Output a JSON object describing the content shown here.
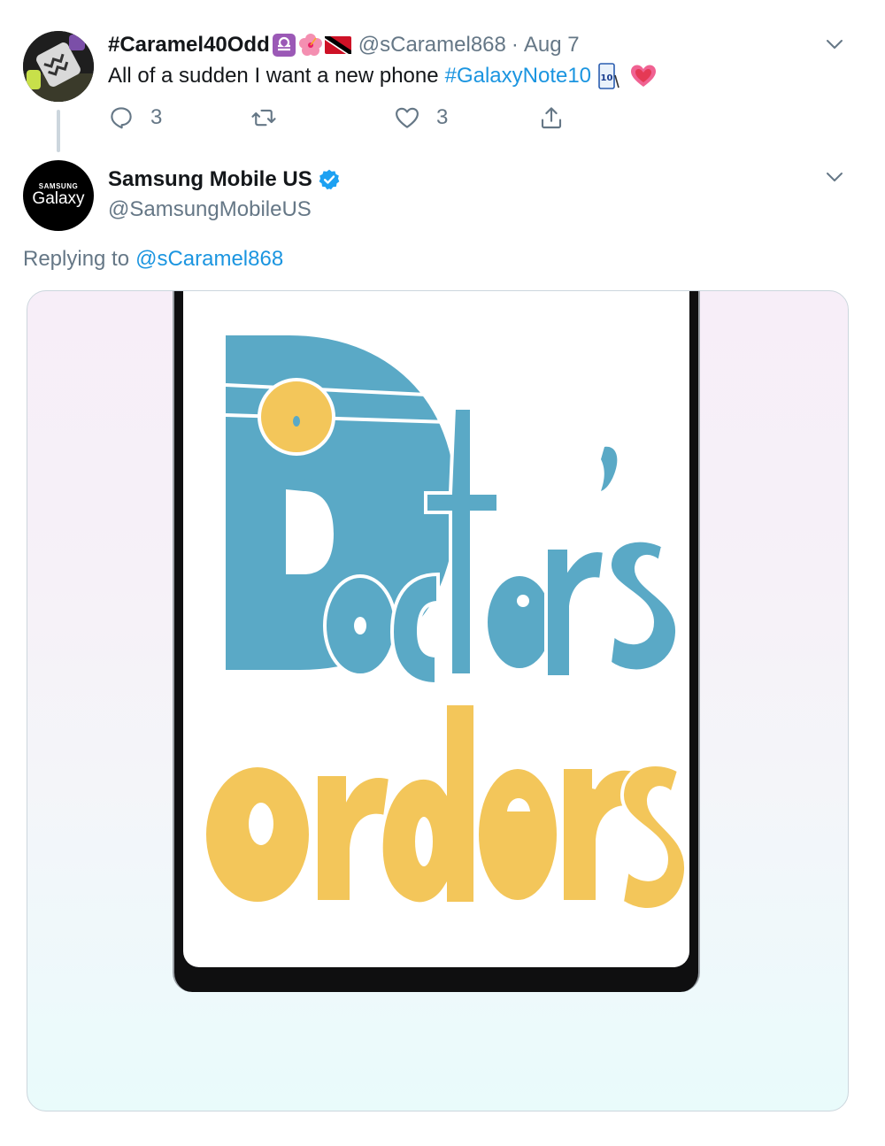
{
  "tweet1": {
    "name": "#Caramel40Odd",
    "name_emojis": [
      "libra-emoji",
      "hibiscus-emoji",
      "trinidad-flag-emoji"
    ],
    "handle": "@sCaramel868",
    "separator": "·",
    "date": "Aug 7",
    "text": "All of a sudden I want a new phone",
    "hashtag": "#GalaxyNote10",
    "trailing_emojis": [
      "note10-emoji",
      "pink-heart-emoji"
    ],
    "actions": {
      "reply_count": "3",
      "retweet_count": "",
      "like_count": "3"
    }
  },
  "tweet2": {
    "name": "Samsung Mobile US",
    "verified": true,
    "handle": "@SamsungMobileUS",
    "avatar": {
      "brand_small": "SAMSUNG",
      "brand_big": "Galaxy"
    },
    "replying_prefix": "Replying to",
    "replying_mention": "@sCaramel868",
    "media": {
      "line1": "Doctor's",
      "line2": "orders"
    }
  },
  "colors": {
    "link": "#1b95e0",
    "muted": "#657786",
    "verified": "#1da1f2",
    "doodle_blue": "#5aa9c6",
    "doodle_yellow": "#f3c65a"
  }
}
